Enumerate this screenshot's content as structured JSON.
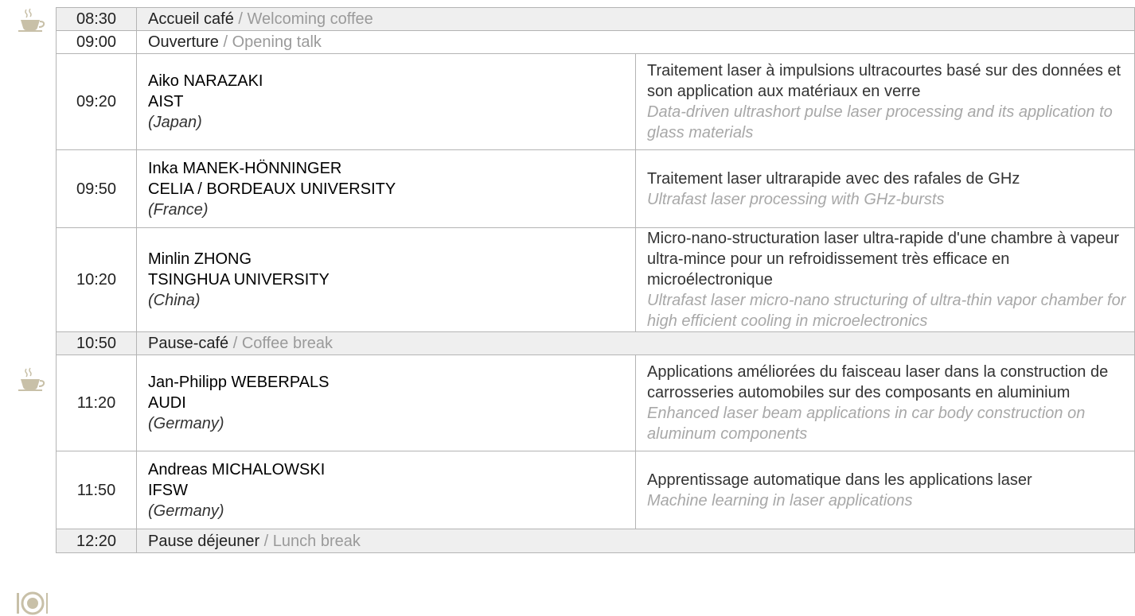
{
  "schedule": {
    "coffee1": {
      "time": "08:30",
      "fr": "Accueil café",
      "sep": "/",
      "en": "Welcoming coffee"
    },
    "opening": {
      "time": "09:00",
      "fr": "Ouverture",
      "sep": "/",
      "en": "Opening talk"
    },
    "talks": [
      {
        "time": "09:20",
        "name": "Aiko NARAZAKI",
        "org": "AIST",
        "country": "(Japan)",
        "title_fr": "Traitement laser à impulsions ultracourtes basé sur des données et son application aux matériaux en verre",
        "title_en": "Data-driven ultrashort pulse laser processing and its application to glass materials"
      },
      {
        "time": "09:50",
        "name": "Inka MANEK-HÖNNINGER",
        "org": "CELIA / BORDEAUX UNIVERSITY",
        "country": "(France)",
        "title_fr": "Traitement laser ultrarapide avec des rafales de GHz",
        "title_en": "Ultrafast laser processing with GHz-bursts"
      },
      {
        "time": "10:20",
        "name": "Minlin ZHONG",
        "org": "TSINGHUA UNIVERSITY",
        "country": "(China)",
        "title_fr": "Micro-nano-structuration laser ultra-rapide d'une chambre à vapeur ultra-mince pour un refroidissement très efficace en microélectronique",
        "title_en": "Ultrafast laser micro-nano structuring of ultra-thin vapor chamber for high efficient cooling in microelectronics"
      }
    ],
    "coffee2": {
      "time": "10:50",
      "fr": "Pause-café",
      "sep": "/",
      "en": "Coffee break"
    },
    "talks2": [
      {
        "time": "11:20",
        "name": "Jan-Philipp WEBERPALS",
        "org": "AUDI",
        "country": "(Germany)",
        "title_fr": "Applications améliorées du faisceau laser dans la construction de carrosseries automobiles sur des composants en aluminium",
        "title_en": "Enhanced laser beam applications in car body construction on aluminum components"
      },
      {
        "time": "11:50",
        "name": "Andreas MICHALOWSKI",
        "org": "IFSW",
        "country": "(Germany)",
        "title_fr": "Apprentissage automatique dans les applications laser",
        "title_en": "Machine learning in laser applications"
      }
    ],
    "lunch": {
      "time": "12:20",
      "fr": "Pause déjeuner",
      "sep": "/",
      "en": "Lunch break"
    }
  },
  "icons": {
    "coffee": "coffee-cup-icon",
    "lunch": "plate-icon",
    "color": "#c8c0a8"
  }
}
